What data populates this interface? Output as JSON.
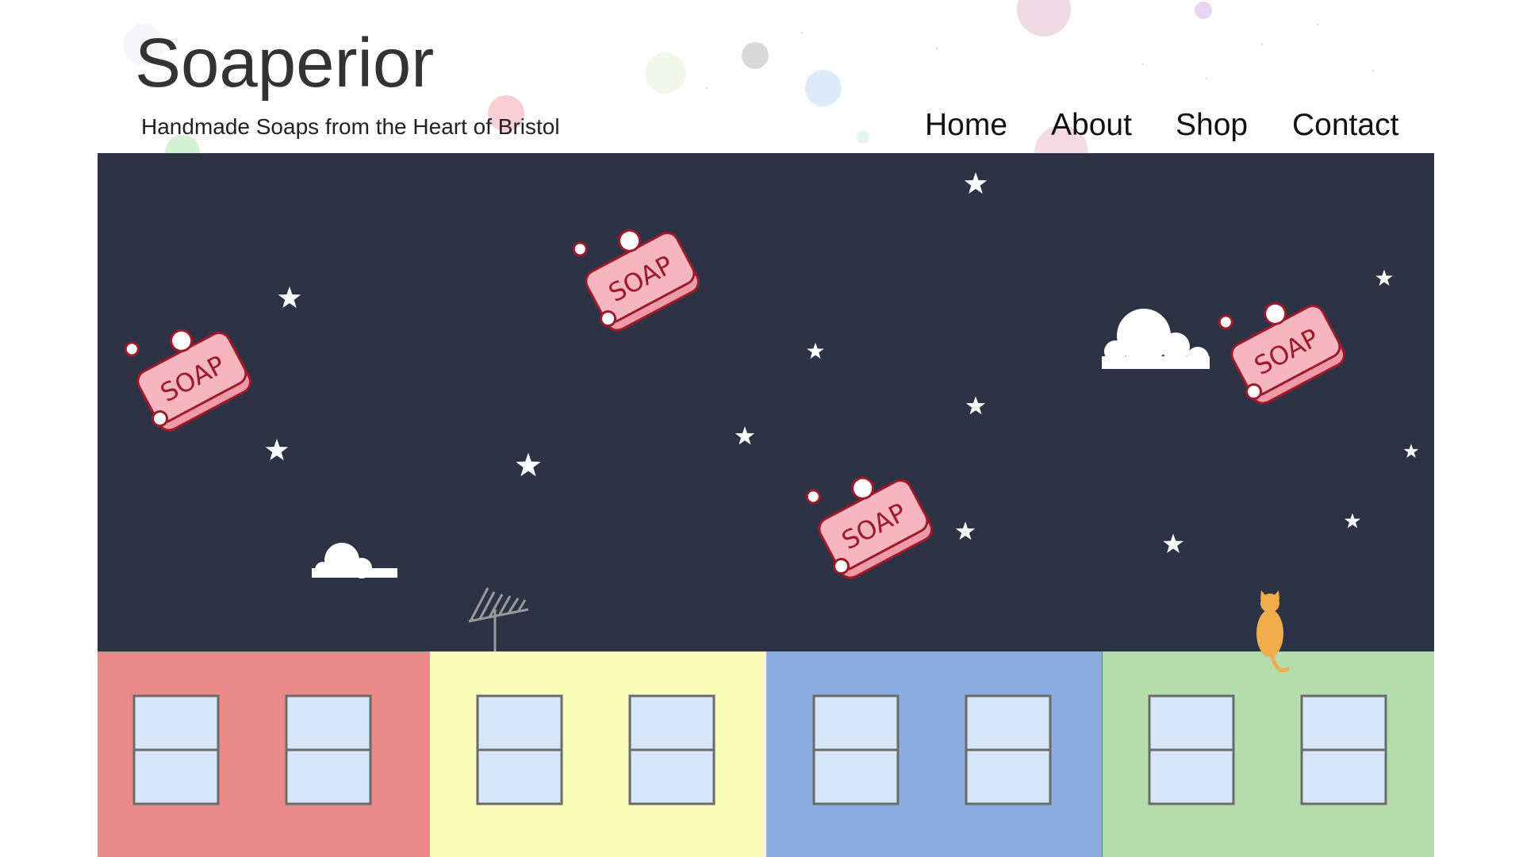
{
  "site": {
    "title": "Soaperior",
    "tagline": "Handmade Soaps from the Heart of Bristol"
  },
  "nav": {
    "items": [
      {
        "label": "Home"
      },
      {
        "label": "About"
      },
      {
        "label": "Shop"
      },
      {
        "label": "Contact"
      }
    ]
  },
  "hero": {
    "soap_label": "SOAP",
    "colors": {
      "sky": "#2d3245",
      "soap": "#f6b6c0",
      "soap_outline": "#9e1a2a",
      "star": "#ffffff",
      "cloud": "#ffffff",
      "cat": "#f0ad4e",
      "house_red": "#e8898a",
      "house_yellow": "#f8fdb7",
      "house_blue": "#8aaedf",
      "house_green": "#b4dcac",
      "window_glass": "#d7e6f6",
      "window_frame": "#6b6b6b"
    }
  }
}
